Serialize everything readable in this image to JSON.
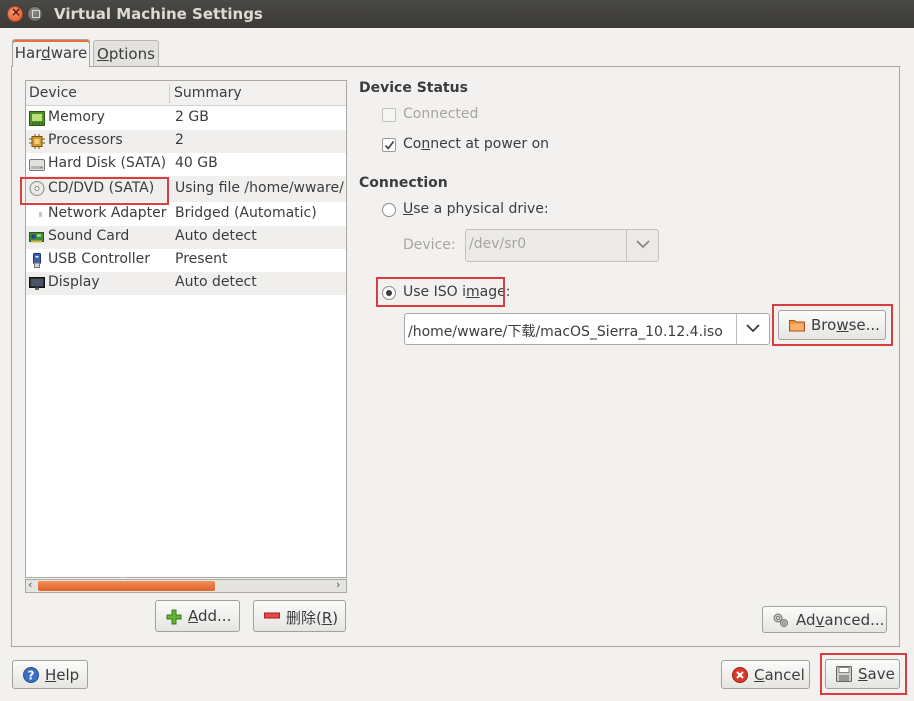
{
  "window": {
    "title": "Virtual Machine Settings"
  },
  "tabs": [
    {
      "label_pre": "Har",
      "label_u": "d",
      "label_post": "ware"
    },
    {
      "label_pre": "",
      "label_u": "O",
      "label_post": "ptions"
    }
  ],
  "devices": {
    "headers": {
      "device": "Device",
      "summary": "Summary"
    },
    "rows": [
      {
        "icon": "memory-icon",
        "name": "Memory",
        "summary": "2 GB"
      },
      {
        "icon": "processor-icon",
        "name": "Processors",
        "summary": "2"
      },
      {
        "icon": "hard-disk-icon",
        "name": "Hard Disk (SATA)",
        "summary": "40 GB"
      },
      {
        "icon": "cd-dvd-icon",
        "name": "CD/DVD (SATA)",
        "summary": "Using file /home/wware/"
      },
      {
        "icon": "network-adapter-icon",
        "name": "Network Adapter",
        "summary": "Bridged (Automatic)"
      },
      {
        "icon": "sound-card-icon",
        "name": "Sound Card",
        "summary": "Auto detect"
      },
      {
        "icon": "usb-icon",
        "name": "USB Controller",
        "summary": "Present"
      },
      {
        "icon": "display-icon",
        "name": "Display",
        "summary": "Auto detect"
      }
    ],
    "scroll_marker": "′′′"
  },
  "buttons": {
    "add": {
      "u": "A",
      "rest": "dd..."
    },
    "remove": {
      "label": "删除(",
      "u": "R",
      "post": ")"
    },
    "advanced": {
      "pre": "Ad",
      "u": "v",
      "post": "anced..."
    },
    "help": {
      "u": "H",
      "rest": "elp"
    },
    "cancel": {
      "u": "C",
      "rest": "ancel"
    },
    "save": {
      "u": "S",
      "rest": "ave"
    },
    "browse": {
      "pre": "Bro",
      "u": "w",
      "post": "se..."
    }
  },
  "device_status": {
    "title": "Device Status",
    "connected": {
      "label": "Connected",
      "checked": false,
      "enabled": false
    },
    "connect_power": {
      "pre": "Co",
      "u": "n",
      "post": "nect at power on",
      "checked": true
    }
  },
  "connection": {
    "title": "Connection",
    "physical": {
      "u": "U",
      "rest": "se a physical drive:"
    },
    "device_label": "Device:",
    "device_value": "/dev/sr0",
    "iso": {
      "pre": "Use ISO i",
      "u": "m",
      "post": "age:"
    },
    "iso_path": "/home/wware/下载/macOS_Sierra_10.12.4.iso"
  },
  "colors": {
    "highlight": "#d93e3e",
    "accent": "#e0622b"
  }
}
